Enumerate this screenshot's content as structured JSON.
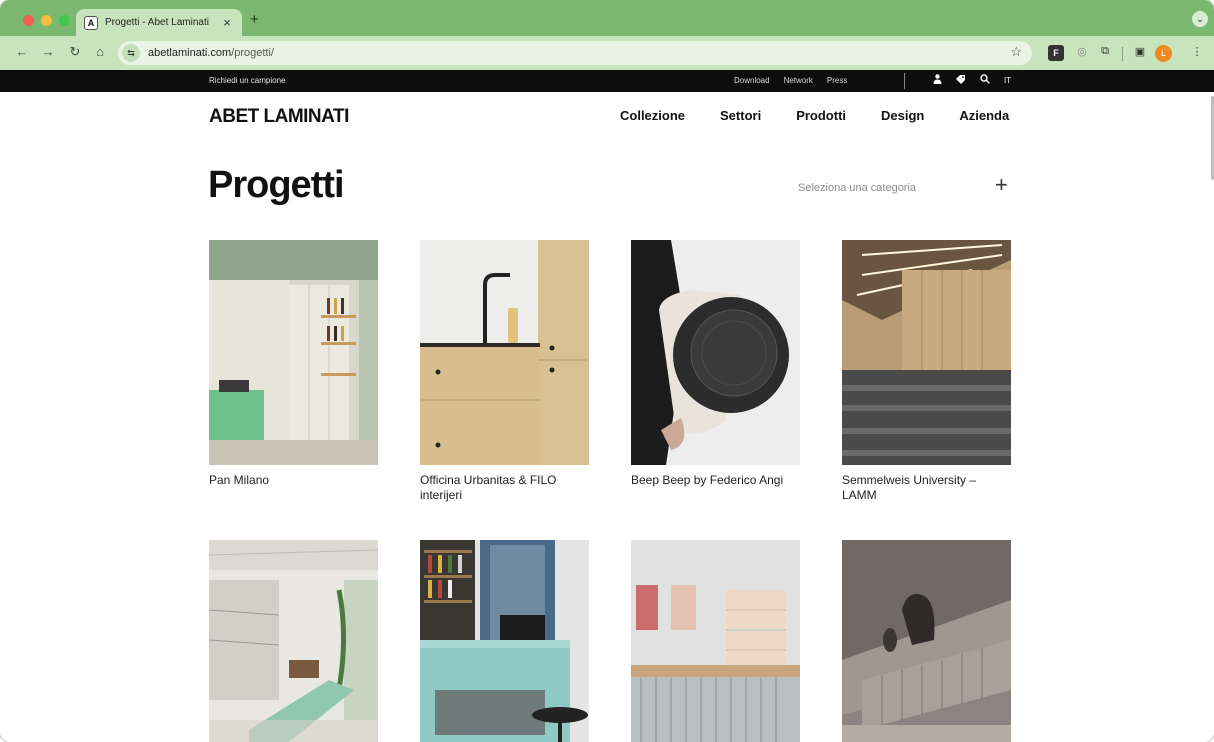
{
  "browser": {
    "tab_title": "Progetti - Abet Laminati",
    "tab_favicon": "A",
    "new_tab": "+",
    "url_domain": "abetlaminati.com",
    "url_path": "/progetti/",
    "profile_initial": "L"
  },
  "topbar": {
    "sample_link": "Richiedi un campione",
    "links": [
      "Download",
      "Network",
      "Press"
    ],
    "lang": "IT"
  },
  "header": {
    "logo": "ABET LAMINATI",
    "nav": [
      "Collezione",
      "Settori",
      "Prodotti",
      "Design",
      "Azienda"
    ]
  },
  "page": {
    "title": "Progetti",
    "category_placeholder": "Seleziona una categoria",
    "category_plus": "+"
  },
  "projects": [
    {
      "title": "Pan Milano"
    },
    {
      "title": "Officina Urbanitas & FILO interijeri"
    },
    {
      "title": "Beep Beep by Federico Angi"
    },
    {
      "title": "Semmelweis University – LAMM"
    },
    {
      "title": ""
    },
    {
      "title": ""
    },
    {
      "title": ""
    },
    {
      "title": ""
    }
  ],
  "colors": {
    "browser_frame": "#7ab86f",
    "toolbar": "#c8e4bd",
    "topbar": "#0d0d0d",
    "text": "#111111"
  },
  "icons": {
    "user": "user-icon",
    "cart": "sample-tag-icon",
    "search": "search-icon"
  }
}
